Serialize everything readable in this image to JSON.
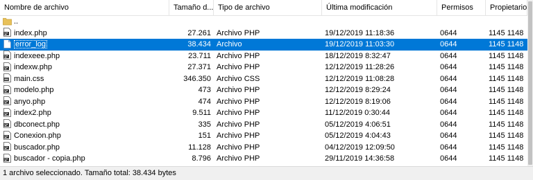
{
  "columns": {
    "name": "Nombre de archivo",
    "size": "Tamaño d...",
    "type": "Tipo de archivo",
    "modified": "Última modificación",
    "permissions": "Permisos",
    "owner": "Propietario..."
  },
  "files": [
    {
      "name": "..",
      "size": "",
      "type": "",
      "modified": "",
      "permissions": "",
      "owner": "",
      "icon": "folder-icon",
      "selected": false
    },
    {
      "name": "index.php",
      "size": "27.261",
      "type": "Archivo PHP",
      "modified": "19/12/2019 11:18:36",
      "permissions": "0644",
      "owner": "1145 1148",
      "icon": "php-file-icon",
      "selected": false
    },
    {
      "name": "error_log",
      "size": "38.434",
      "type": "Archivo",
      "modified": "19/12/2019 11:03:30",
      "permissions": "0644",
      "owner": "1145 1148",
      "icon": "file-icon",
      "selected": true
    },
    {
      "name": "indexeee.php",
      "size": "23.711",
      "type": "Archivo PHP",
      "modified": "18/12/2019 8:32:47",
      "permissions": "0644",
      "owner": "1145 1148",
      "icon": "php-file-icon",
      "selected": false
    },
    {
      "name": "indexw.php",
      "size": "27.371",
      "type": "Archivo PHP",
      "modified": "12/12/2019 11:28:26",
      "permissions": "0644",
      "owner": "1145 1148",
      "icon": "php-file-icon",
      "selected": false
    },
    {
      "name": "main.css",
      "size": "346.350",
      "type": "Archivo CSS",
      "modified": "12/12/2019 11:08:28",
      "permissions": "0644",
      "owner": "1145 1148",
      "icon": "css-file-icon",
      "selected": false
    },
    {
      "name": "modelo.php",
      "size": "473",
      "type": "Archivo PHP",
      "modified": "12/12/2019 8:29:24",
      "permissions": "0644",
      "owner": "1145 1148",
      "icon": "php-file-icon",
      "selected": false
    },
    {
      "name": "anyo.php",
      "size": "474",
      "type": "Archivo PHP",
      "modified": "12/12/2019 8:19:06",
      "permissions": "0644",
      "owner": "1145 1148",
      "icon": "php-file-icon",
      "selected": false
    },
    {
      "name": "index2.php",
      "size": "9.511",
      "type": "Archivo PHP",
      "modified": "11/12/2019 0:30:44",
      "permissions": "0644",
      "owner": "1145 1148",
      "icon": "php-file-icon",
      "selected": false
    },
    {
      "name": "dbconect.php",
      "size": "335",
      "type": "Archivo PHP",
      "modified": "05/12/2019 4:06:51",
      "permissions": "0644",
      "owner": "1145 1148",
      "icon": "php-file-icon",
      "selected": false
    },
    {
      "name": "Conexion.php",
      "size": "151",
      "type": "Archivo PHP",
      "modified": "05/12/2019 4:04:43",
      "permissions": "0644",
      "owner": "1145 1148",
      "icon": "php-file-icon",
      "selected": false
    },
    {
      "name": "buscador.php",
      "size": "11.128",
      "type": "Archivo PHP",
      "modified": "04/12/2019 12:09:50",
      "permissions": "0644",
      "owner": "1145 1148",
      "icon": "php-file-icon",
      "selected": false
    },
    {
      "name": "buscador - copia.php",
      "size": "8.796",
      "type": "Archivo PHP",
      "modified": "29/11/2019 14:36:58",
      "permissions": "0644",
      "owner": "1145 1148",
      "icon": "php-file-icon",
      "selected": false
    }
  ],
  "status_text": "1 archivo seleccionado. Tamaño total: 38.434 bytes",
  "colors": {
    "selection": "#0078d7",
    "folder": "#e8c15a",
    "status_bg": "#f0f0f0"
  }
}
